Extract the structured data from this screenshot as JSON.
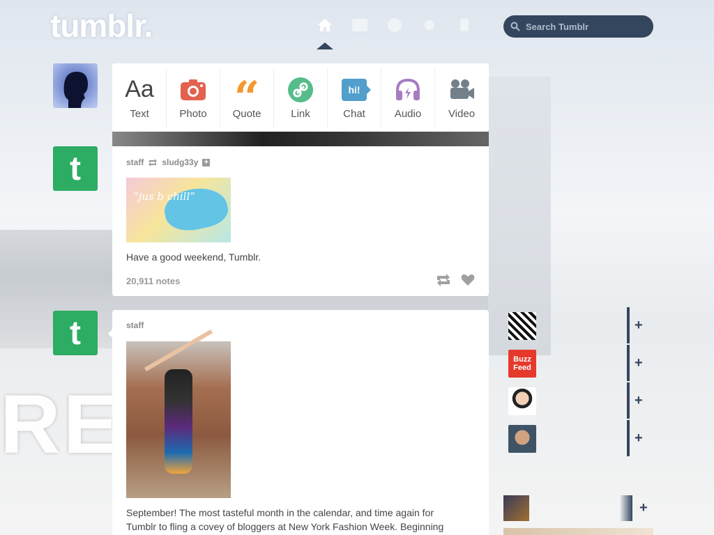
{
  "header": {
    "logo": "tumblr.",
    "search": {
      "placeholder": "Search Tumblr",
      "value": ""
    },
    "nav_icons": [
      "home-icon",
      "inbox-icon",
      "explore-icon",
      "activity-icon",
      "account-icon"
    ]
  },
  "composer": {
    "types": [
      {
        "label": "Text",
        "glyph": "Aa",
        "icon": "text-icon",
        "color": "#444444"
      },
      {
        "label": "Photo",
        "icon": "camera-icon",
        "color": "#e2624e"
      },
      {
        "label": "Quote",
        "glyph": "“",
        "icon": "quote-icon",
        "color": "#f2992e"
      },
      {
        "label": "Link",
        "icon": "link-icon",
        "color": "#56bc8a"
      },
      {
        "label": "Chat",
        "glyph": "hi!",
        "icon": "chat-icon",
        "color": "#529ecc"
      },
      {
        "label": "Audio",
        "icon": "headphones-icon",
        "color": "#a77dc2"
      },
      {
        "label": "Video",
        "icon": "video-camera-icon",
        "color": "#748089"
      }
    ]
  },
  "posts": [
    {
      "author": "staff",
      "reblogged_from": "sludg33y",
      "image_text": "“jus b chill”",
      "caption": "Have a good weekend, Tumblr.",
      "notes": "20,911 notes"
    },
    {
      "author": "staff",
      "caption_lines": [
        "September! The most tasteful month in the calendar, and time again for",
        "Tumblr to fling a covey of bloggers at New York Fashion Week. Beginning"
      ]
    }
  ],
  "avatars": {
    "tumblr_letter": "t"
  },
  "recommended": [
    {
      "icon": "blog-avatar",
      "thumb_text": ""
    },
    {
      "icon": "buzzfeed-avatar",
      "thumb_text": "Buzz Feed"
    },
    {
      "icon": "blog-avatar",
      "thumb_text": ""
    },
    {
      "icon": "blog-avatar",
      "thumb_text": ""
    }
  ],
  "follow_glyph": "+",
  "colors": {
    "navy": "#34465d",
    "tumblr_green": "#2dac63"
  }
}
